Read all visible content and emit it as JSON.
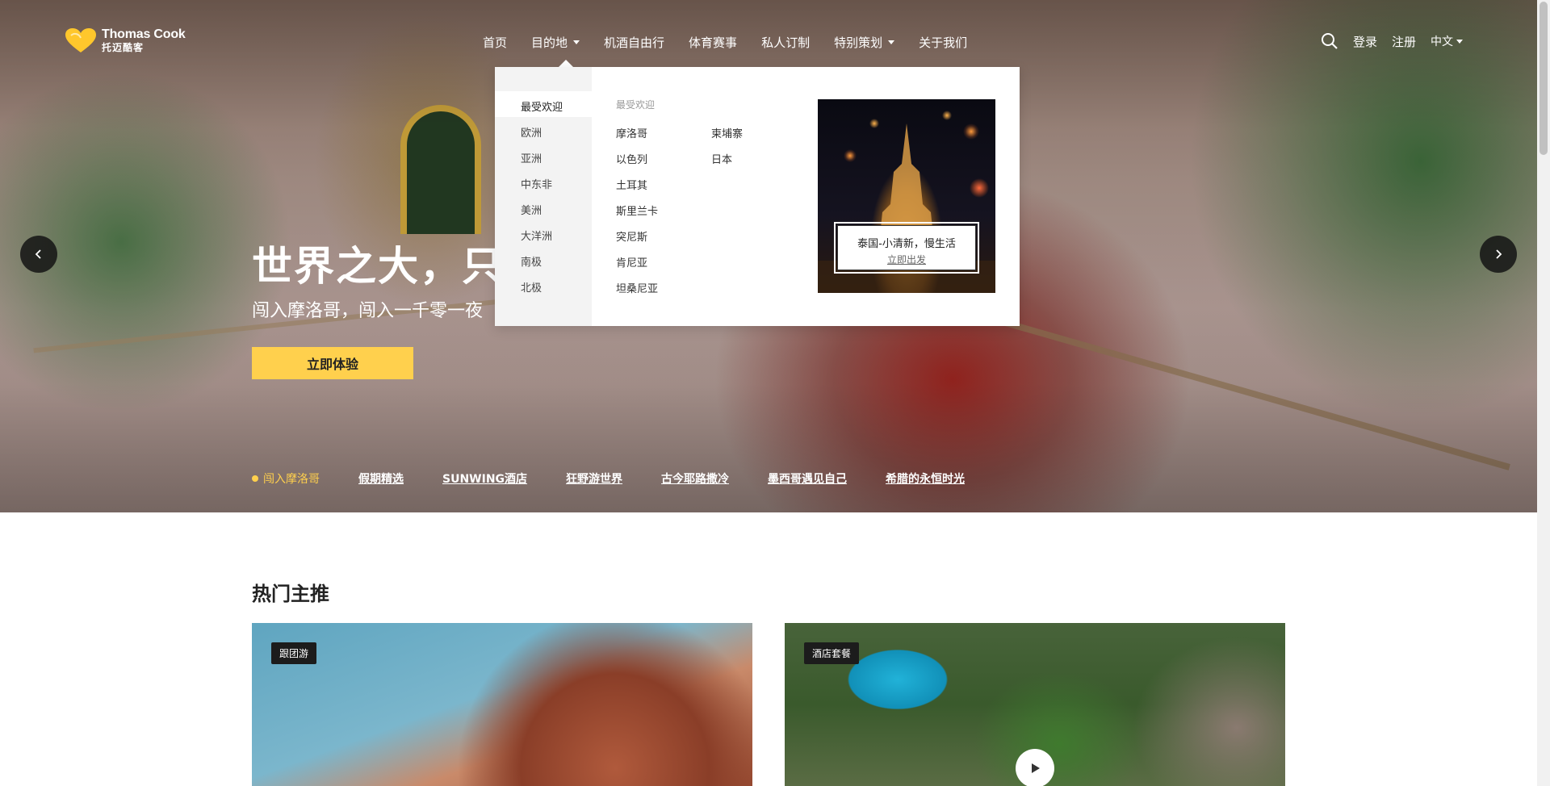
{
  "brand": {
    "name_en": "Thomas Cook",
    "name_cn": "托迈酷客",
    "accent": "#ffd04d"
  },
  "nav": {
    "items": [
      {
        "label": "首页",
        "has_caret": false
      },
      {
        "label": "目的地",
        "has_caret": true
      },
      {
        "label": "机酒自由行",
        "has_caret": false
      },
      {
        "label": "体育赛事",
        "has_caret": false
      },
      {
        "label": "私人订制",
        "has_caret": false
      },
      {
        "label": "特别策划",
        "has_caret": true
      },
      {
        "label": "关于我们",
        "has_caret": false
      }
    ],
    "search_icon": "search-icon",
    "login": "登录",
    "register": "注册",
    "language": "中文"
  },
  "dropdown": {
    "regions": [
      "最受欢迎",
      "欧洲",
      "亚洲",
      "中东非",
      "美洲",
      "大洋洲",
      "南极",
      "北极"
    ],
    "active_region": "最受欢迎",
    "column_title": "最受欢迎",
    "destinations_col1": [
      "摩洛哥",
      "以色列",
      "土耳其",
      "斯里兰卡",
      "突尼斯",
      "肯尼亚",
      "坦桑尼亚"
    ],
    "destinations_col2": [
      "柬埔寨",
      "日本"
    ],
    "promo": {
      "title": "泰国-小清新，慢生活",
      "link": "立即出发"
    }
  },
  "hero": {
    "title": "世界之大，只消",
    "subtitle": "闯入摩洛哥，闯入一千零一夜",
    "cta": "立即体验",
    "tabs": [
      "闯入摩洛哥",
      "假期精选",
      "SUNWING酒店",
      "狂野游世界",
      "古今耶路撒冷",
      "墨西哥遇见自己",
      "希腊的永恒时光"
    ],
    "active_tab": 0
  },
  "hot": {
    "title": "热门主推",
    "cards": [
      {
        "badge": "跟团游",
        "has_play": false
      },
      {
        "badge": "酒店套餐",
        "has_play": true
      }
    ]
  }
}
